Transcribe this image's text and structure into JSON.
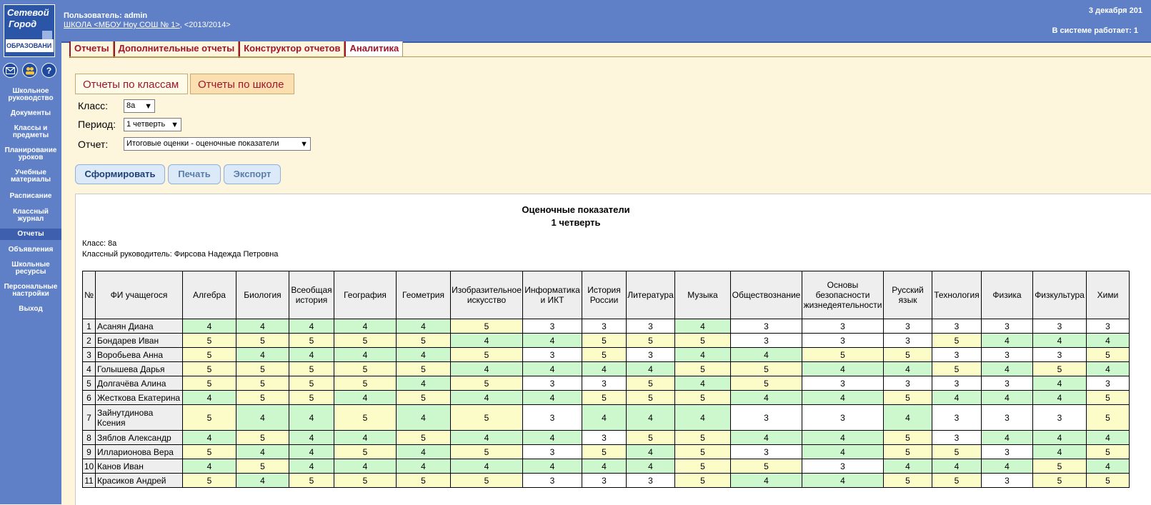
{
  "sidebar": {
    "logo": {
      "line1": "Сетевой",
      "line2": "Город",
      "line3": "ОБРАЗОВАНИ"
    },
    "icons": [
      "mail-icon",
      "users-icon",
      "help-icon"
    ],
    "help_glyph": "?",
    "items": [
      {
        "label": "Школьное руководство",
        "key": "school-management"
      },
      {
        "label": "Документы",
        "key": "documents"
      },
      {
        "label": "Классы и предметы",
        "key": "classes-subjects"
      },
      {
        "label": "Планирование уроков",
        "key": "lesson-planning"
      },
      {
        "label": "Учебные материалы",
        "key": "learning-materials"
      },
      {
        "label": "Расписание",
        "key": "schedule"
      },
      {
        "label": "Классный журнал",
        "key": "class-journal"
      },
      {
        "label": "Отчеты",
        "key": "reports",
        "active": true
      },
      {
        "label": "Объявления",
        "key": "announcements"
      },
      {
        "label": "Школьные ресурсы",
        "key": "school-resources"
      },
      {
        "label": "Персональные настройки",
        "key": "personal-settings"
      },
      {
        "label": "Выход",
        "key": "logout"
      }
    ]
  },
  "header": {
    "user": "Пользователь: admin",
    "school_link": "ШКОЛА <МБОУ Ноу СОШ № 1>",
    "year": ",  <2013/2014>",
    "date": "3 декабря 201",
    "online": "В системе работает: 1"
  },
  "tabs": [
    {
      "label": "Отчеты"
    },
    {
      "label": "Дополнительные отчеты"
    },
    {
      "label": "Конструктор отчетов"
    },
    {
      "label": "Аналитика",
      "active": true
    }
  ],
  "subtabs": [
    {
      "label": "Отчеты по классам",
      "active": true
    },
    {
      "label": "Отчеты по школе"
    }
  ],
  "form": {
    "class_label": "Класс:",
    "class_value": "8а",
    "period_label": "Период:",
    "period_value": "1 четверть",
    "report_label": "Отчет:",
    "report_value": "Итоговые оценки - оценочные показатели"
  },
  "buttons": {
    "generate": "Сформировать",
    "print": "Печать",
    "export": "Экспорт"
  },
  "report": {
    "title": "Оценочные показатели",
    "subtitle": "1 четверть",
    "class_line": "Класс: 8а",
    "teacher_line": "Классный руководитель: Фирсова Надежда Петровна",
    "columns": [
      "№",
      "ФИ учащегося",
      "Алгебра",
      "Биология",
      "Всеобщая история",
      "География",
      "Геометрия",
      "Изобразительное искусство",
      "Информатика и ИКТ",
      "История России",
      "Литература",
      "Музыка",
      "Обществознание",
      "Основы безопасности жизнедеятельности",
      "Русский язык",
      "Технология",
      "Физика",
      "Физкультура",
      "Хими"
    ],
    "rows": [
      {
        "n": "1",
        "name": "Асанян Диана",
        "grades": [
          "4",
          "4",
          "4",
          "4",
          "4",
          "5",
          "3",
          "3",
          "3",
          "4",
          "3",
          "3",
          "3",
          "3",
          "3",
          "3",
          "3"
        ]
      },
      {
        "n": "2",
        "name": "Бондарев Иван",
        "grades": [
          "5",
          "5",
          "5",
          "5",
          "5",
          "4",
          "4",
          "5",
          "5",
          "5",
          "3",
          "3",
          "3",
          "5",
          "4",
          "4",
          "4"
        ]
      },
      {
        "n": "3",
        "name": "Воробьева Анна",
        "grades": [
          "5",
          "4",
          "4",
          "4",
          "4",
          "5",
          "3",
          "5",
          "3",
          "4",
          "4",
          "5",
          "5",
          "3",
          "3",
          "3",
          "5"
        ]
      },
      {
        "n": "4",
        "name": "Голышева Дарья",
        "grades": [
          "5",
          "5",
          "5",
          "5",
          "5",
          "4",
          "4",
          "4",
          "4",
          "5",
          "5",
          "4",
          "4",
          "5",
          "4",
          "5",
          "4"
        ]
      },
      {
        "n": "5",
        "name": "Долгачёва Алина",
        "grades": [
          "5",
          "5",
          "5",
          "5",
          "4",
          "5",
          "3",
          "3",
          "5",
          "4",
          "5",
          "3",
          "3",
          "3",
          "3",
          "4",
          "3"
        ]
      },
      {
        "n": "6",
        "name": "Жесткова Екатерина",
        "grades": [
          "4",
          "5",
          "5",
          "4",
          "5",
          "4",
          "4",
          "5",
          "5",
          "5",
          "4",
          "4",
          "5",
          "4",
          "4",
          "4",
          "5"
        ]
      },
      {
        "n": "7",
        "name": "Зайнутдинова Ксения",
        "grades": [
          "5",
          "4",
          "4",
          "5",
          "4",
          "5",
          "3",
          "4",
          "4",
          "4",
          "3",
          "3",
          "4",
          "3",
          "3",
          "3",
          "5"
        ]
      },
      {
        "n": "8",
        "name": "Зяблов Александр",
        "grades": [
          "4",
          "5",
          "4",
          "4",
          "5",
          "4",
          "4",
          "3",
          "5",
          "5",
          "4",
          "4",
          "5",
          "3",
          "4",
          "4",
          "4"
        ]
      },
      {
        "n": "9",
        "name": "Илларионова Вера",
        "grades": [
          "5",
          "4",
          "4",
          "5",
          "4",
          "5",
          "3",
          "5",
          "4",
          "5",
          "3",
          "4",
          "5",
          "5",
          "3",
          "4",
          "5"
        ]
      },
      {
        "n": "10",
        "name": "Канов Иван",
        "grades": [
          "4",
          "5",
          "4",
          "4",
          "4",
          "4",
          "4",
          "4",
          "4",
          "5",
          "5",
          "3",
          "4",
          "4",
          "4",
          "5",
          "4"
        ]
      },
      {
        "n": "11",
        "name": "Красиков Андрей",
        "grades": [
          "5",
          "4",
          "5",
          "5",
          "5",
          "5",
          "3",
          "3",
          "3",
          "5",
          "4",
          "4",
          "5",
          "5",
          "3",
          "5",
          "5"
        ]
      }
    ]
  }
}
